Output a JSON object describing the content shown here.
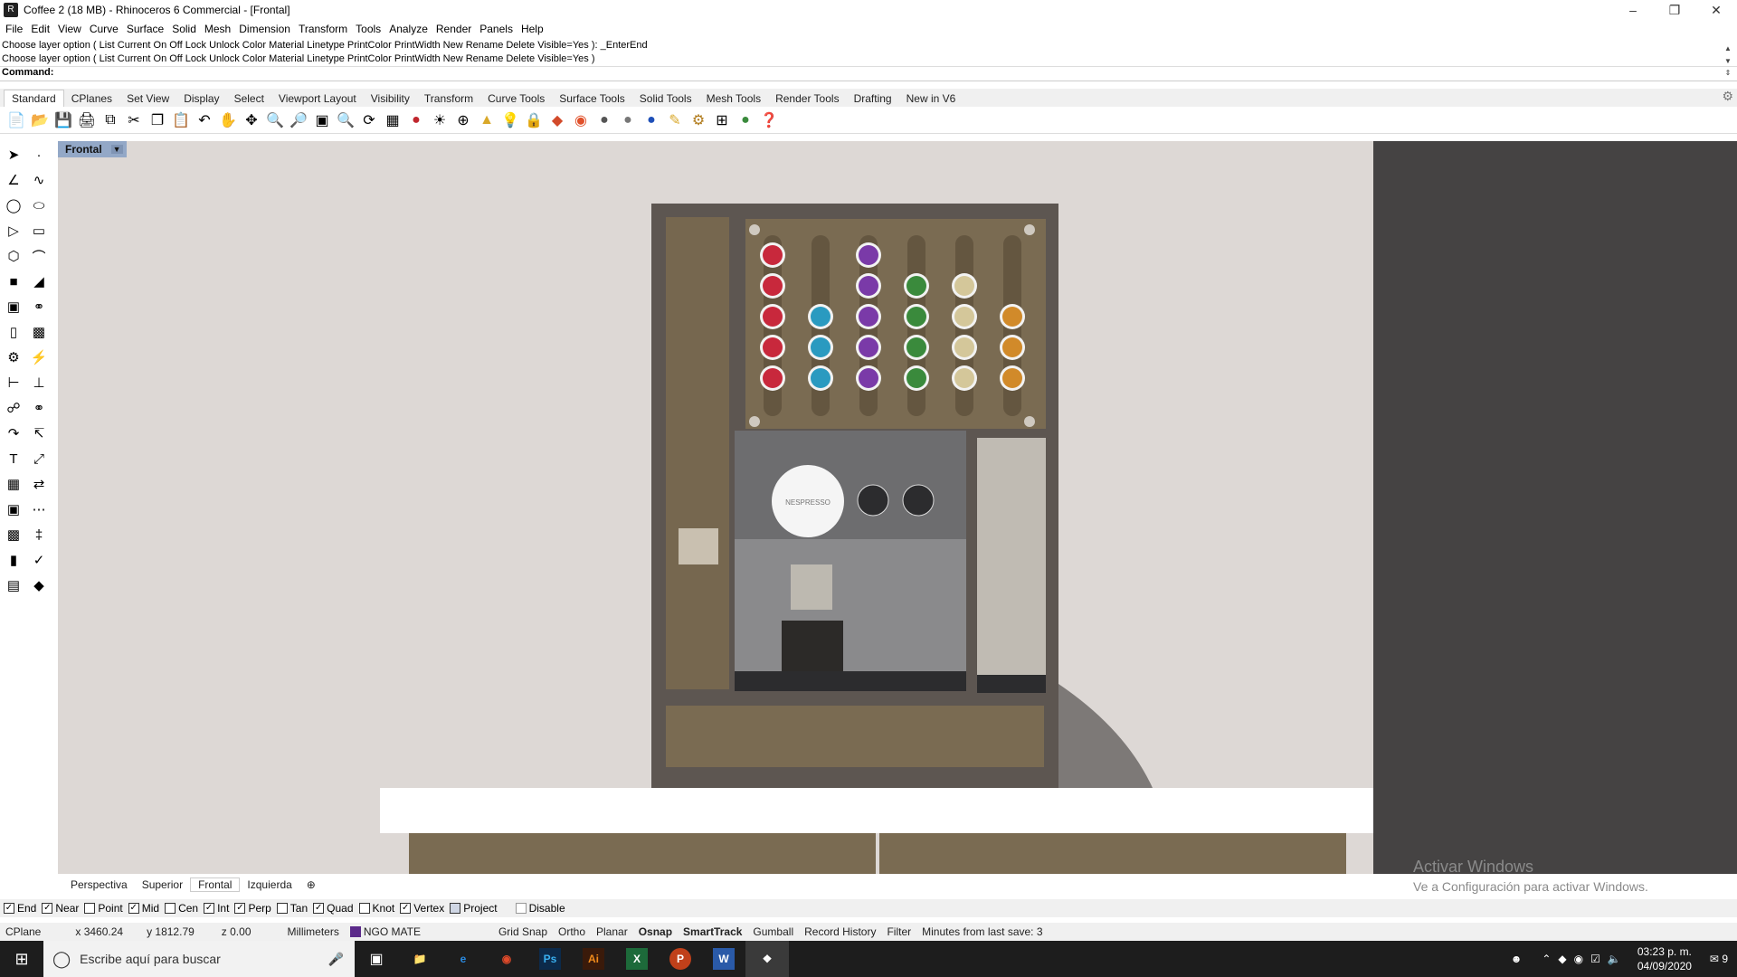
{
  "window": {
    "title": "Coffee 2 (18 MB) - Rhinoceros 6 Commercial - [Frontal]",
    "buttons": [
      "minimize",
      "restore",
      "close"
    ]
  },
  "menu": [
    "File",
    "Edit",
    "View",
    "Curve",
    "Surface",
    "Solid",
    "Mesh",
    "Dimension",
    "Transform",
    "Tools",
    "Analyze",
    "Render",
    "Panels",
    "Help"
  ],
  "command": {
    "history": [
      "Choose layer option ( List  Current  On  Off  Lock  Unlock  Color  Material  Linetype  PrintColor  PrintWidth  New  Rename  Delete  Visible=Yes ): _EnterEnd",
      "Choose layer option ( List  Current  On  Off  Lock  Unlock  Color  Material  Linetype  PrintColor  PrintWidth  New  Rename  Delete  Visible=Yes )"
    ],
    "prompt": "Command:",
    "value": ""
  },
  "toolbar_tabs": [
    "Standard",
    "CPlanes",
    "Set View",
    "Display",
    "Select",
    "Viewport Layout",
    "Visibility",
    "Transform",
    "Curve Tools",
    "Surface Tools",
    "Solid Tools",
    "Mesh Tools",
    "Render Tools",
    "Drafting",
    "New in V6"
  ],
  "active_toolbar_tab": "Standard",
  "toolbar_icons": [
    "new-icon",
    "open-icon",
    "save-icon",
    "print-icon",
    "import-icon",
    "cut-icon",
    "copy-icon",
    "paste-icon",
    "undo-icon",
    "pan-icon",
    "move-icon",
    "zoom-icon",
    "zoom-window-icon",
    "zoom-extents-icon",
    "zoom-selected-icon",
    "rotate-view-icon",
    "four-view-icon",
    "car-icon",
    "light-icon",
    "cplane-icon",
    "properties-icon",
    "bulb-icon",
    "lock-icon",
    "layer-icon",
    "color-wheel-icon",
    "material-icon",
    "render-sphere-icon",
    "render-blue-icon",
    "flashlight-icon",
    "options-icon",
    "grid-icon",
    "plugin-icon",
    "help-icon"
  ],
  "viewport": {
    "active_name": "Frontal",
    "tabs": [
      "Perspectiva",
      "Superior",
      "Frontal",
      "Izquierda"
    ],
    "active_tab": "Frontal",
    "capsule_columns": [
      {
        "color": "#c8283c",
        "count": 5
      },
      {
        "color": "#2a9ac0",
        "count": 3
      },
      {
        "color": "#7a3aa8",
        "count": 5
      },
      {
        "color": "#3a8a3c",
        "count": 4
      },
      {
        "color": "#d4c79a",
        "count": 4
      },
      {
        "color": "#d18a2a",
        "count": 3
      }
    ],
    "machine_brand": "NESPRESSO"
  },
  "watermark": {
    "line1": "Activar Windows",
    "line2": "Ve a Configuración para activar Windows."
  },
  "osnaps": [
    {
      "label": "End",
      "checked": true
    },
    {
      "label": "Near",
      "checked": true
    },
    {
      "label": "Point",
      "checked": false
    },
    {
      "label": "Mid",
      "checked": true
    },
    {
      "label": "Cen",
      "checked": false
    },
    {
      "label": "Int",
      "checked": true
    },
    {
      "label": "Perp",
      "checked": true
    },
    {
      "label": "Tan",
      "checked": false
    },
    {
      "label": "Quad",
      "checked": true
    },
    {
      "label": "Knot",
      "checked": false
    },
    {
      "label": "Vertex",
      "checked": true
    },
    {
      "label": "Project",
      "checked": false
    },
    {
      "label": "Disable",
      "checked": false
    }
  ],
  "status": {
    "cplane": "CPlane",
    "x": "x 3460.24",
    "y": "y 1812.79",
    "z": "z 0.00",
    "units": "Millimeters",
    "layer": "NGO MATE",
    "layer_color": "#5b2a8a",
    "grid_snap": "Grid Snap",
    "ortho": "Ortho",
    "planar": "Planar",
    "osnap": "Osnap",
    "smarttrack": "SmartTrack",
    "gumball": "Gumball",
    "record_history": "Record History",
    "filter": "Filter",
    "last_save": "Minutes from last save: 3"
  },
  "taskbar": {
    "search_placeholder": "Escribe aquí para buscar",
    "apps": [
      "task-view-icon",
      "file-explorer-icon",
      "edge-icon",
      "chrome-icon",
      "photoshop-icon",
      "illustrator-icon",
      "excel-icon",
      "powerpoint-icon",
      "word-icon",
      "rhino-icon"
    ],
    "time": "03:23 p. m.",
    "date": "04/09/2020",
    "notifications": "9"
  }
}
